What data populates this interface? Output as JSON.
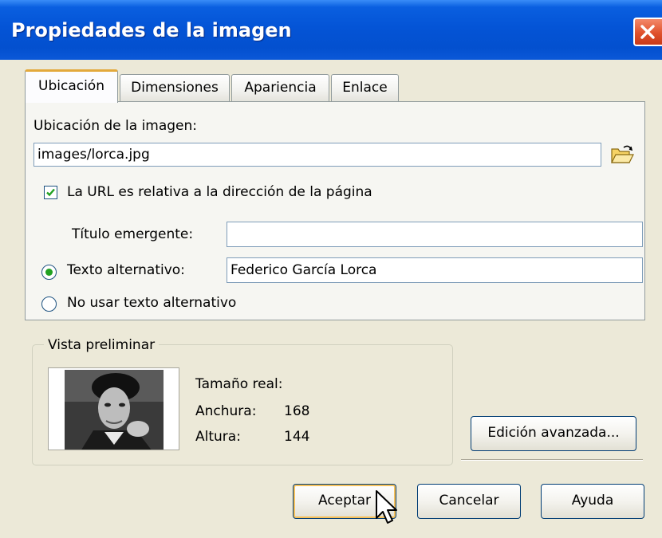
{
  "window": {
    "title": "Propiedades de la imagen"
  },
  "tabs": [
    {
      "label": "Ubicación",
      "active": true
    },
    {
      "label": "Dimensiones",
      "active": false
    },
    {
      "label": "Apariencia",
      "active": false
    },
    {
      "label": "Enlace",
      "active": false
    }
  ],
  "location": {
    "label": "Ubicación de la imagen:",
    "value": "images/lorca.jpg",
    "relative_url_label": "La URL es relativa a la dirección de la página",
    "relative_url_checked": true,
    "tooltip_label": "Título emergente:",
    "tooltip_value": "",
    "alt_text_label": "Texto alternativo:",
    "alt_text_value": "Federico García Lorca",
    "alt_text_selected": true,
    "no_alt_label": "No usar texto alternativo"
  },
  "preview": {
    "legend": "Vista preliminar",
    "real_size_label": "Tamaño real:",
    "width_label": "Anchura:",
    "width_value": "168",
    "height_label": "Altura:",
    "height_value": "144"
  },
  "buttons": {
    "advanced_edit": "Edición avanzada...",
    "ok": "Aceptar",
    "cancel": "Cancelar",
    "help": "Ayuda"
  },
  "icons": {
    "close": "close-icon",
    "browse": "open-folder-icon",
    "cursor": "mouse-pointer-icon"
  },
  "colors": {
    "titlebar": "#0454d6",
    "close_button": "#e0512c",
    "dialog_bg": "#ece9d8",
    "active_tab_accent": "#e3a93b",
    "check_green": "#21a121"
  }
}
